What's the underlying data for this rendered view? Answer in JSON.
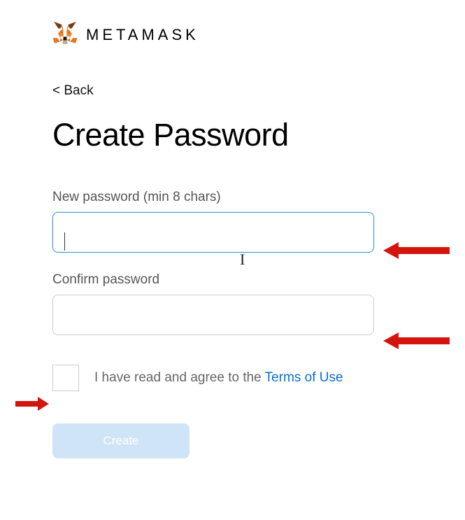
{
  "header": {
    "brand": "METAMASK"
  },
  "nav": {
    "back_label": "< Back"
  },
  "page": {
    "title": "Create Password"
  },
  "form": {
    "new_password_label": "New password (min 8 chars)",
    "new_password_value": "",
    "confirm_password_label": "Confirm password",
    "confirm_password_value": "",
    "terms_prefix": "I have read and agree to the ",
    "terms_link": "Terms of Use",
    "create_button": "Create"
  },
  "colors": {
    "link": "#0a6ed1",
    "button_disabled_bg": "#cfe4f7",
    "input_focus_border": "#3b99e0",
    "annotation_arrow": "#d4150d"
  }
}
